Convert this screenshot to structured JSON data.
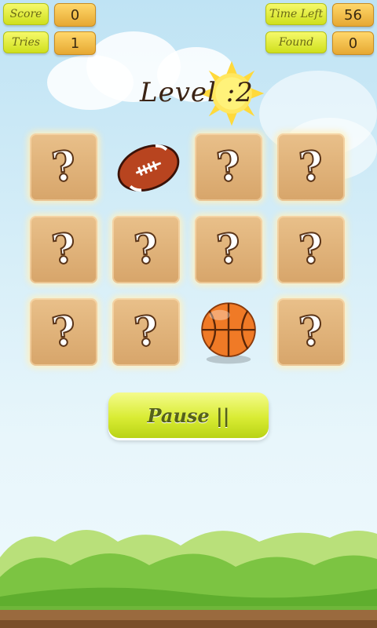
{
  "hud": {
    "score_label": "Score",
    "score_value": "0",
    "tries_label": "Tries",
    "tries_value": "1",
    "time_left_label": "Time Left",
    "time_left_value": "56",
    "found_label": "Found",
    "found_value": "0"
  },
  "level": {
    "title": "Level :2"
  },
  "board": {
    "hidden_symbol": "?",
    "cards": [
      {
        "state": "hidden"
      },
      {
        "state": "revealed",
        "content": "american-football-icon"
      },
      {
        "state": "hidden"
      },
      {
        "state": "hidden"
      },
      {
        "state": "hidden"
      },
      {
        "state": "hidden"
      },
      {
        "state": "hidden"
      },
      {
        "state": "hidden"
      },
      {
        "state": "hidden"
      },
      {
        "state": "hidden"
      },
      {
        "state": "revealed",
        "content": "basketball-icon"
      },
      {
        "state": "hidden"
      }
    ]
  },
  "pause_button": {
    "label": "Pause ||"
  },
  "colors": {
    "sky": "#cfeaf6",
    "card": "#ddb074",
    "button": "#d9ec34",
    "hud_label": "#e6f03a",
    "hud_value": "#f0bc46"
  }
}
